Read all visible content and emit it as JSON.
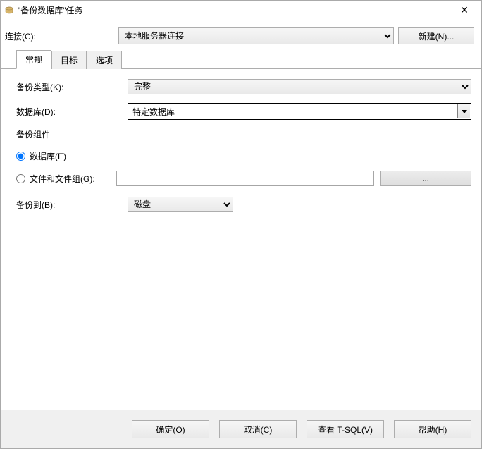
{
  "window": {
    "title": "\"备份数据库\"任务",
    "close": "✕"
  },
  "connection": {
    "label": "连接(C):",
    "value": "本地服务器连接",
    "new_button": "新建(N)..."
  },
  "tabs": [
    {
      "label": "常规",
      "active": true
    },
    {
      "label": "目标",
      "active": false
    },
    {
      "label": "选项",
      "active": false
    }
  ],
  "form": {
    "backup_type_label": "备份类型(K):",
    "backup_type_value": "完整",
    "database_label": "数据库(D):",
    "database_value": "特定数据库",
    "component_label": "备份组件",
    "radio_db_label": "数据库(E)",
    "radio_files_label": "文件和文件组(G):",
    "files_value": "",
    "browse_button": "...",
    "backup_to_label": "备份到(B):",
    "backup_to_value": "磁盘"
  },
  "buttons": {
    "ok": "确定(O)",
    "cancel": "取消(C)",
    "tsql": "查看 T-SQL(V)",
    "help": "帮助(H)"
  }
}
